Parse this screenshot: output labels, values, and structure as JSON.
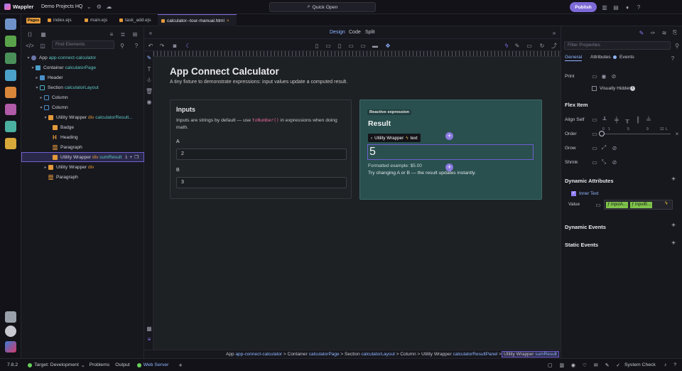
{
  "app": {
    "name": "Wappler",
    "project": "Demo Projects HQ",
    "quick_open": "Quick Open",
    "publish": "Publish"
  },
  "tabs": [
    {
      "label": "index.ejs"
    },
    {
      "label": "main.ejs"
    },
    {
      "label": "task_add.ejs"
    },
    {
      "label": "calculator--tour-manual.html"
    }
  ],
  "pages_badge": "Pages",
  "left": {
    "filter_placeholder": "Find Elements",
    "tree": [
      {
        "name": "App",
        "id": "app-connect-calculator"
      },
      {
        "name": "Container",
        "id": "calculatorPage"
      },
      {
        "name": "Header",
        "id": ""
      },
      {
        "name": "Section",
        "id": "calculatorLayout"
      },
      {
        "name": "Column",
        "id": ""
      },
      {
        "name": "Column",
        "id": ""
      },
      {
        "name": "Utility Wrapper",
        "tag": "div",
        "id": "calculatorResult..."
      },
      {
        "name": "Badge",
        "id": ""
      },
      {
        "name": "Heading",
        "id": ""
      },
      {
        "name": "Paragraph",
        "id": ""
      },
      {
        "name": "Utility Wrapper",
        "tag": "div",
        "id": "sumResult"
      },
      {
        "name": "Utility Wrapper",
        "tag": "div",
        "id": ""
      },
      {
        "name": "Paragraph",
        "id": ""
      }
    ]
  },
  "designbar": {
    "design": "Design",
    "code": "Code",
    "split": "Split"
  },
  "canvas": {
    "title": "App Connect Calculator",
    "subtitle": "A tiny fixture to demonstrate expressions: input values update a computed result.",
    "inputs_title": "Inputs",
    "inputs_desc_1": "Inputs are strings by default — use",
    "inputs_code": "toNumber()",
    "inputs_desc_2": "in expressions when doing math.",
    "label_a": "A",
    "value_a": "2",
    "label_b": "B",
    "value_b": "3",
    "badge": "Reactive expression",
    "result_title": "Result",
    "result_value": "5",
    "tooltip": "Utility Wrapper",
    "tooltip_tag": "text",
    "formatted": "Formatted example: $5.00",
    "hint": "Try changing A or B — the result updates instantly."
  },
  "breadcrumb": [
    {
      "name": "App",
      "id": "app-connect-calculator"
    },
    {
      "name": "Container",
      "id": "calculatorPage"
    },
    {
      "name": "Section",
      "id": "calculatorLayout"
    },
    {
      "name": "Column",
      "id": ""
    },
    {
      "name": "Utility Wrapper",
      "id": "calculatorResultPanel"
    },
    {
      "name": "Utility Wrapper",
      "id": "sumResult"
    }
  ],
  "right": {
    "filter_placeholder": "Filter Properties",
    "tabs": [
      "General",
      "Attributes",
      "Events"
    ],
    "print": "Print",
    "visually_hidden": "Visually Hidden",
    "flex_item": "Flex Item",
    "align_self": "Align Self",
    "order": "Order",
    "order_ticks": [
      "0",
      "1",
      "5",
      "9",
      "12",
      "L"
    ],
    "grow": "Grow",
    "shrink": "Shrink",
    "dynamic_attributes": "Dynamic Attributes",
    "inner_text": "Inner Text",
    "value": "Value",
    "value_tokens": [
      "inputA...",
      "inputB..."
    ],
    "dynamic_events": "Dynamic Events",
    "static_events": "Static Events"
  },
  "status": {
    "version": "7.8.2",
    "target_label": "Target:",
    "target": "Development",
    "problems": "Problems",
    "output": "Output",
    "web_server": "Web Server",
    "system_check": "System Check"
  },
  "colors": {
    "accent": "#7e6ad7",
    "result_bg": "#2a4f4f",
    "highlight": "#7ec24a"
  }
}
